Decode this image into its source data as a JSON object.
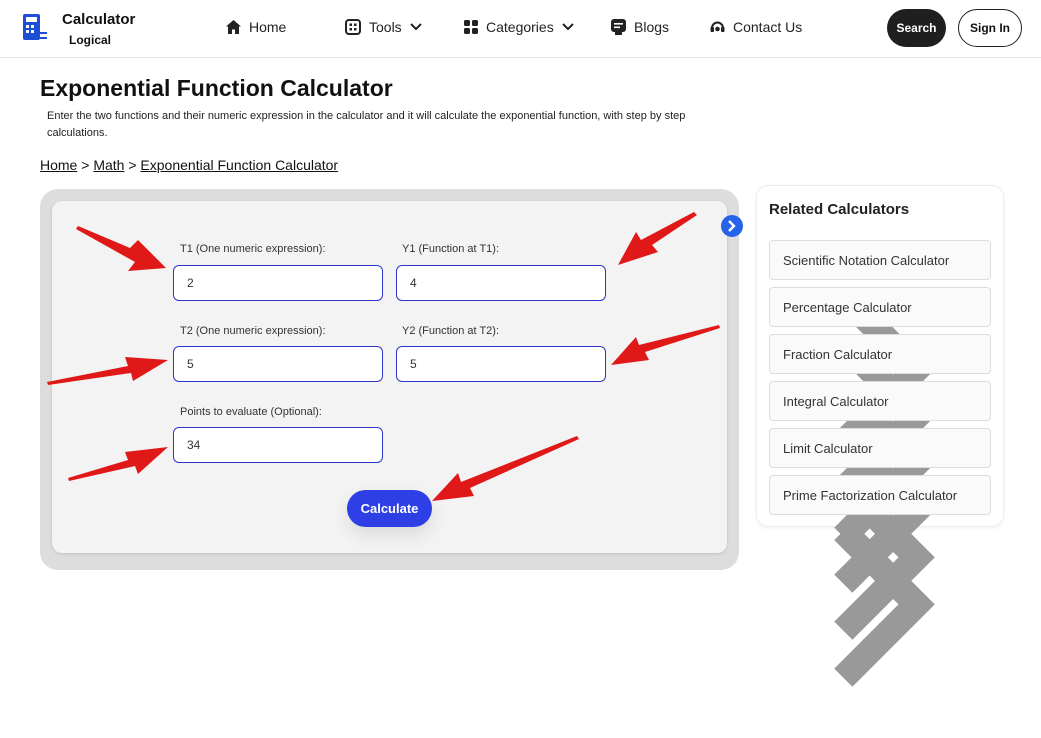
{
  "header": {
    "logo_title": "Calculator",
    "logo_sub": "Logical",
    "nav": {
      "home": "Home",
      "tools": "Tools",
      "categories": "Categories",
      "blogs": "Blogs",
      "contact": "Contact Us"
    },
    "search_label": "Search",
    "signin_label": "Sign In"
  },
  "page": {
    "title": "Exponential Function Calculator",
    "description": "Enter the two functions and their numeric expression in the calculator and it will calculate the exponential function, with step by step calculations.",
    "breadcrumb": {
      "home": "Home",
      "sep1": ">",
      "math": "Math",
      "sep2": ">",
      "current": "Exponential Function Calculator"
    }
  },
  "calculator": {
    "t1_label": "T1 (One numeric expression):",
    "t1_value": "2",
    "y1_label": "Y1 (Function at T1):",
    "y1_value": "4",
    "t2_label": "T2 (One numeric expression):",
    "t2_value": "5",
    "y2_label": "Y2 (Function at T2):",
    "y2_value": "5",
    "points_label": "Points to evaluate (Optional):",
    "points_value": "34",
    "calculate_label": "Calculate"
  },
  "related": {
    "title": "Related Calculators",
    "items": [
      "Scientific Notation Calculator",
      "Percentage Calculator",
      "Fraction Calculator",
      "Integral Calculator",
      "Limit Calculator",
      "Prime Factorization Calculator"
    ]
  },
  "colors": {
    "accent": "#2f3fe6",
    "input_border": "#2b36c9",
    "annotation_arrow": "#e01818",
    "dark_button": "#1f1f1f"
  },
  "icons": [
    "calculator-logo-icon",
    "home-icon",
    "tools-icon",
    "categories-icon",
    "chevron-down-icon",
    "blogs-icon",
    "contact-icon",
    "chevron-right-icon",
    "arrow-annotation-icon"
  ]
}
